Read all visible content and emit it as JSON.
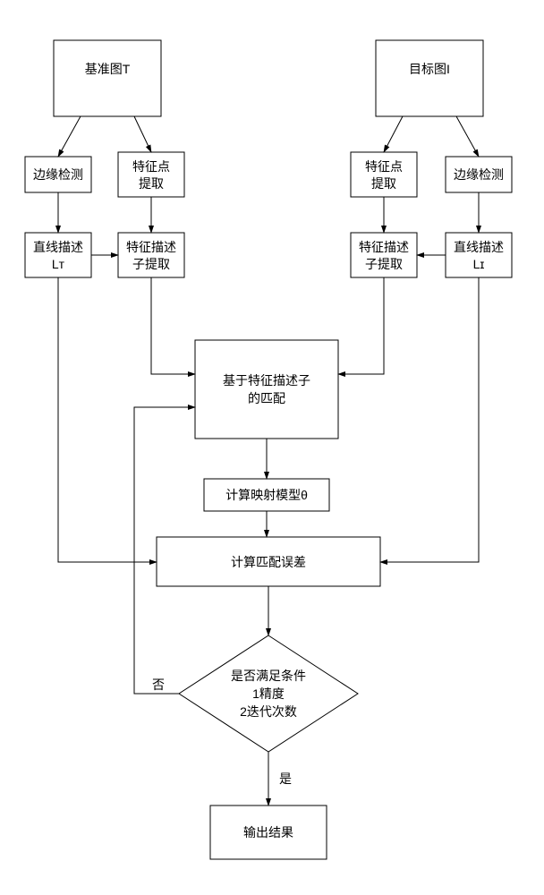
{
  "chart_data": {
    "type": "flowchart",
    "nodes": [
      {
        "id": "ref",
        "label": "基准图T"
      },
      {
        "id": "tgt",
        "label": "目标图I"
      },
      {
        "id": "ed_l",
        "label": "边缘检测"
      },
      {
        "id": "fp_l",
        "label": "特征点提取"
      },
      {
        "id": "fp_r",
        "label": "特征点提取"
      },
      {
        "id": "ed_r",
        "label": "边缘检测"
      },
      {
        "id": "ld_l",
        "label": "直线描述 Lᴛ"
      },
      {
        "id": "fd_l",
        "label": "特征描述子提取"
      },
      {
        "id": "fd_r",
        "label": "特征描述子提取"
      },
      {
        "id": "ld_r",
        "label": "直线描述 Lɪ"
      },
      {
        "id": "match",
        "label": "基于特征描述子的匹配"
      },
      {
        "id": "map",
        "label": "计算映射模型θ"
      },
      {
        "id": "err",
        "label": "计算匹配误差"
      },
      {
        "id": "dec",
        "label": "是否满足条件\n1精度\n2迭代次数"
      },
      {
        "id": "out",
        "label": "输出结果"
      }
    ],
    "edges": [
      [
        "ref",
        "ed_l"
      ],
      [
        "ref",
        "fp_l"
      ],
      [
        "tgt",
        "fp_r"
      ],
      [
        "tgt",
        "ed_r"
      ],
      [
        "ed_l",
        "ld_l"
      ],
      [
        "fp_l",
        "fd_l"
      ],
      [
        "fp_r",
        "fd_r"
      ],
      [
        "ed_r",
        "ld_r"
      ],
      [
        "ld_l",
        "fd_l"
      ],
      [
        "ld_r",
        "fd_r"
      ],
      [
        "fd_l",
        "match"
      ],
      [
        "fd_r",
        "match"
      ],
      [
        "match",
        "map"
      ],
      [
        "map",
        "err"
      ],
      [
        "ld_l",
        "err"
      ],
      [
        "ld_r",
        "err"
      ],
      [
        "err",
        "dec"
      ],
      {
        "from": "dec",
        "to": "out",
        "label": "是"
      },
      {
        "from": "dec",
        "to": "match",
        "label": "否"
      }
    ]
  },
  "labels": {
    "ref": "基准图T",
    "tgt": "目标图I",
    "edge_detect": "边缘检测",
    "feature_extract_l1": "特征点",
    "feature_extract_l2": "提取",
    "line_desc_l1": "直线描述",
    "line_desc_Lt": "Lᴛ",
    "line_desc_Li": "Lɪ",
    "feat_desc_l1": "特征描述",
    "feat_desc_l2": "子提取",
    "match_l1": "基于特征描述子",
    "match_l2": "的匹配",
    "map": "计算映射模型θ",
    "err": "计算匹配误差",
    "dec_l1": "是否满足条件",
    "dec_l2": "1精度",
    "dec_l3": "2迭代次数",
    "out": "输出结果",
    "yes": "是",
    "no": "否"
  }
}
